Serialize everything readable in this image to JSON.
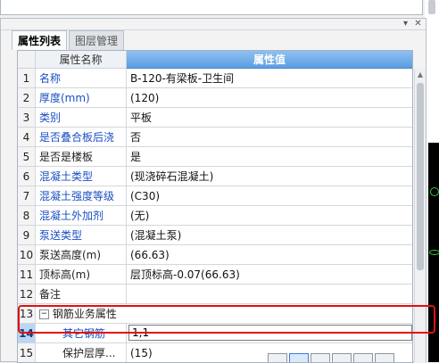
{
  "tabs": [
    {
      "label": "属性列表"
    },
    {
      "label": "图层管理"
    }
  ],
  "grid": {
    "header": {
      "name": "属性名称",
      "value": "属性值"
    },
    "rows": [
      {
        "num": "1",
        "name": "名称",
        "value": "B-120-有梁板-卫生间"
      },
      {
        "num": "2",
        "name": "厚度(mm)",
        "value": "(120)"
      },
      {
        "num": "3",
        "name": "类别",
        "value": "平板"
      },
      {
        "num": "4",
        "name": "是否叠合板后浇",
        "value": "否"
      },
      {
        "num": "5",
        "name": "是否是楼板",
        "value": "是"
      },
      {
        "num": "6",
        "name": "混凝土类型",
        "value": "(现浇碎石混凝土)"
      },
      {
        "num": "7",
        "name": "混凝土强度等级",
        "value": "(C30)"
      },
      {
        "num": "8",
        "name": "混凝土外加剂",
        "value": "(无)"
      },
      {
        "num": "9",
        "name": "泵送类型",
        "value": "(混凝土泵)"
      },
      {
        "num": "10",
        "name": "泵送高度(m)",
        "value": "(66.63)"
      },
      {
        "num": "11",
        "name": "顶标高(m)",
        "value": "层顶标高-0.07(66.63)"
      },
      {
        "num": "12",
        "name": "备注",
        "value": ""
      },
      {
        "num": "13",
        "name": "钢筋业务属性",
        "value": "",
        "toggle": "−"
      },
      {
        "num": "14",
        "name": "其它钢筋",
        "value": "1,1"
      },
      {
        "num": "15",
        "name": "保护层厚...",
        "value": "(15)"
      }
    ]
  },
  "colors": {
    "link": "#1b4fc4",
    "header_accent": "#5b9ee2",
    "highlight": "#e01010",
    "selected_row": "#b9d6f5"
  }
}
